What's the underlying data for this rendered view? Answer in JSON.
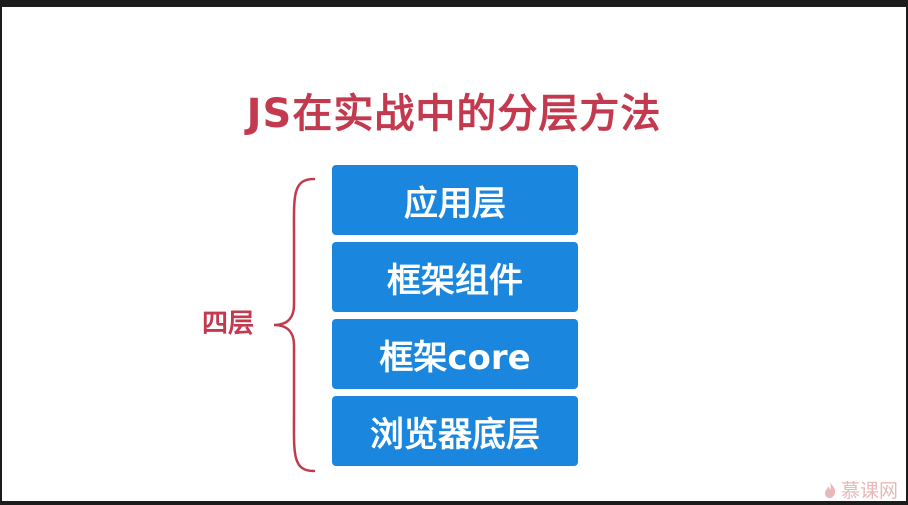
{
  "slide": {
    "title": "JS在实战中的分层方法",
    "side_label": "四层",
    "accent_color": "#c33a4e",
    "layer_color": "#1a86dd",
    "layers": [
      {
        "label": "应用层"
      },
      {
        "label": "框架组件"
      },
      {
        "label": "框架core"
      },
      {
        "label": "浏览器底层"
      }
    ],
    "watermark": "慕课网"
  }
}
